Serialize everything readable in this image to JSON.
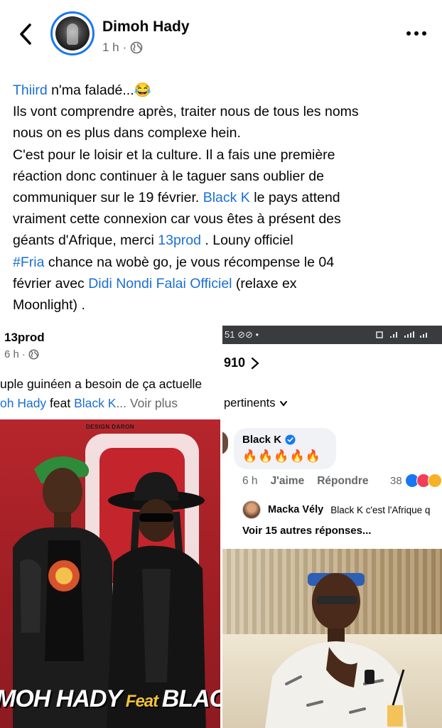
{
  "header": {
    "author": "Dimoh Hady",
    "time": "1 h",
    "separator": "·",
    "privacy_icon": "globe-icon",
    "back_icon": "chevron-left-icon",
    "more_icon": "more-dots-icon"
  },
  "post": {
    "mention1": "Thiird",
    "l1_rest": " n'ma faladé...😂",
    "l2": "Ils vont comprendre après, traiter nous de tous les noms",
    "l3": "nous on es plus dans complexe hein.",
    "l4": "C'est pour le loisir et la culture. Il a fais une première",
    "l5": "réaction donc continuer à le taguer sans oublier de",
    "l6_a": "communiquer sur le 19 février. ",
    "mention2": "Black K",
    "l6_b": " le pays attend",
    "l7": "vraiment cette connexion car vous êtes à présent des",
    "l8_a": "géants d'Afrique, merci ",
    "mention3": "13prod",
    "l8_b": " . Louny officiel",
    "hashtag": "#Fria",
    "l9_b": " chance na wobè go, je vous récompense le 04",
    "l10_a": "février avec ",
    "mention4": "Didi Nondi Falai Officiel",
    "l10_b": " (relaxe ex",
    "l11": "Moonlight) ."
  },
  "left_card": {
    "name": "13prod",
    "time": "6 h",
    "separator": "·",
    "text1": "uple guinéen a besoin de ça actuelle",
    "text2_link1": "oh Hady",
    "text2_feat": " feat ",
    "text2_link2": "Black K",
    "text2_more": "... Voir plus",
    "poster_design": "DESIGN DARON",
    "poster_title_a": "MOH HADY",
    "poster_title_feat": " Feat ",
    "poster_title_b": "BLACK"
  },
  "comments_card": {
    "status_left": "51 ⊘⊘ •",
    "count": "910",
    "sort": "pertinents",
    "commenter": "Black K",
    "comment": "🔥🔥🔥🔥🔥",
    "comment_time": "6 h",
    "like": "J'aime",
    "reply": "Répondre",
    "reactions_count": "38",
    "reply_name": "Macka Vély",
    "reply_text": "Black K c'est l'Afrique q",
    "more_replies": "Voir 15 autres réponses..."
  },
  "colors": {
    "link": "#1a6fd4",
    "secondary": "#65676b",
    "accent": "#1877f2"
  }
}
